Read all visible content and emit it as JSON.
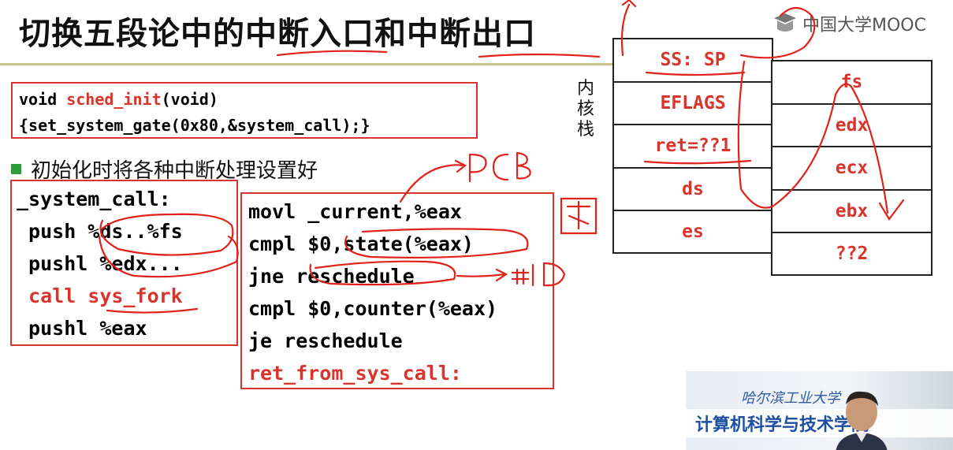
{
  "slide": {
    "title": "切换五段论中的中断入口和中断出口",
    "logo_text": "中国大学MOOC",
    "init_code": {
      "line1_a": "void ",
      "line1_fn": "sched_init",
      "line1_b": "(void)",
      "line2": "{set_system_gate(0x80,&system_call);}"
    },
    "bullet": "初始化时将各种中断处理设置好",
    "system_call_code": [
      {
        "text": "_system_call:",
        "red": false
      },
      {
        "text": " push %ds..%fs",
        "red": false
      },
      {
        "text": " pushl %edx...",
        "red": false
      },
      {
        "text": " call sys_fork",
        "red": true
      },
      {
        "text": " pushl %eax",
        "red": false
      }
    ],
    "current_code": [
      {
        "text": "movl _current,%eax",
        "red": false
      },
      {
        "text": "cmpl $0,state(%eax)",
        "red": false
      },
      {
        "text": "jne reschedule",
        "red": false
      },
      {
        "text": "cmpl $0,counter(%eax)",
        "red": false
      },
      {
        "text": "je reschedule",
        "red": false
      },
      {
        "text": "ret_from_sys_call:",
        "red": true
      }
    ],
    "kernel_stack_label": "内核栈",
    "stack_left": [
      "SS: SP",
      "EFLAGS",
      "ret=??1",
      "ds",
      "es"
    ],
    "stack_right": [
      "fs",
      "edx",
      "ecx",
      "ebx",
      "??2"
    ],
    "handwritten": {
      "pcb": "PCB",
      "tu": "图",
      "neq_zero": "非0"
    },
    "video": {
      "school_text": "哈尔滨工业大学",
      "dept_text": "计算机科学与技术学院"
    },
    "colors": {
      "accent_red": "#d9342b",
      "bullet_green": "#2e9c3a",
      "rule_gold": "#c9c48a"
    }
  }
}
